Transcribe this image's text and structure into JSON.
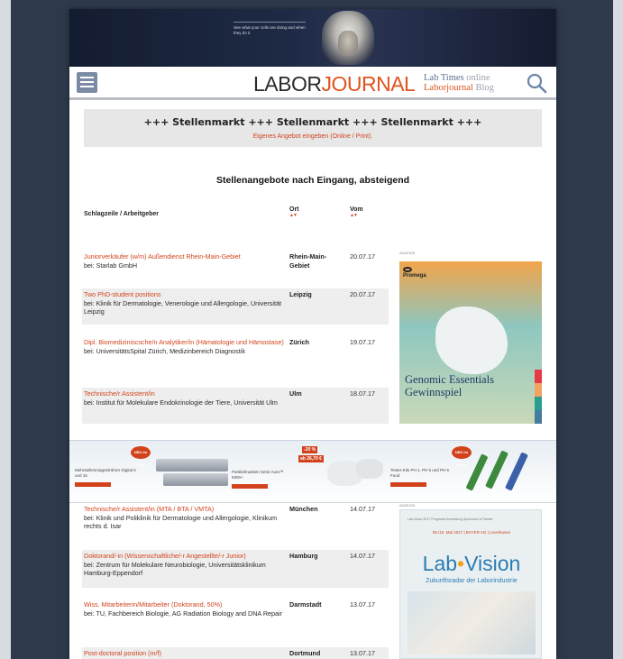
{
  "banner": {
    "small_text": "",
    "tagline": "See what your cells are doing and when they do it"
  },
  "header": {
    "logo_part1": "LABOR",
    "logo_part2": "JOURNAL",
    "link1_main": "Lab Times",
    "link1_suffix": " online",
    "link2_main": "Laborjournal",
    "link2_suffix": " Blog"
  },
  "stellenmarkt": {
    "title": "+++ Stellenmarkt +++ Stellenmarkt +++ Stellenmarkt +++",
    "submit_link": "Eigenes Angebot eingeben (Online / Print)."
  },
  "listing": {
    "heading": "Stellenangebote nach Eingang, absteigend",
    "col_headline": "Schlagzeile / Arbeitgeber",
    "col_ort": "Ort",
    "col_vom": "Vom",
    "sort_arrows": "▲▼"
  },
  "jobs": [
    {
      "title": "Juniorverkäufer (w/m) Außendienst Rhein-Main-Gebiet",
      "employer": "bei: Starlab GmbH",
      "ort": "Rhein-Main-Gebiet",
      "date": "20.07.17"
    },
    {
      "title": "Two PhD-student positions",
      "employer": "bei: Klinik für Dermatologie, Venerologie und Allergologie, Universität Leipzig",
      "ort": "Leipzig",
      "date": "20.07.17"
    },
    {
      "title": "Dipl. Biomediziniscsche/n Analytiker/in (Hämatologie und Hämostase)",
      "employer": "bei: UniversitätsSpital Zürich, Medizinbereich Diagnostik",
      "ort": "Zürich",
      "date": "19.07.17"
    },
    {
      "title": "Technische/r Assistent/in",
      "employer": "bei: Institut für Molekulare Endokrinologie der Tiere, Universität Ulm",
      "ort": "Ulm",
      "date": "18.07.17"
    },
    {
      "title": "Technische/r Assistent/in (MTA / BTA / VMTA)",
      "employer": "bei: Klinik und Poliklinik für Dermatologie und Allergologie, Klinikum rechts d. Isar",
      "ort": "München",
      "date": "14.07.17"
    },
    {
      "title": "Doktorand/-in (Wissenschaftliche/-r Angestellte/-r Junior)",
      "employer": "bei: Zentrum für Molekulare Neurobiologie, Universitätsklinikum Hamburg-Eppendorf",
      "ort": "Hamburg",
      "date": "14.07.17"
    },
    {
      "title": "Wiss. Mitarbeiterin/Mitarbeiter (Doktorand, 50%)",
      "employer": "bei: TU, Fachbereich Biologie, AG Radiation Biology and DNA Repair",
      "ort": "Darmstadt",
      "date": "13.07.17"
    },
    {
      "title": "Post-doctoral position (m/f)",
      "employer": "",
      "ort": "Dortmund",
      "date": "13.07.17"
    }
  ],
  "ads": {
    "label": "ANZEIGE",
    "promega_brand": "Promega",
    "promega_line1": "Genomic Essentials",
    "promega_line2": "Gewinnspiel",
    "labvision_nav": "Lab-Vision 2017   Programm   Anmeldung   Sponsoren & Partner",
    "labvision_date": "09./10. Mai 2017 | BAYER AG | Leverkusen",
    "labvision_logo1": "Lab",
    "labvision_dot": "•",
    "labvision_logo2": "Vision",
    "labvision_sub": "Zukunftsradar der Laborindustrie"
  },
  "product_banner": {
    "item1": "Mehrstellenmagnetrührer Digital 6 und 15",
    "item2": "Partikelmasken Serie Aura™ 9300+",
    "item3": "Tester-Kits PH 1, PH 5 und PH 5 Food",
    "badge": "NEU im Shop",
    "discount": "-20 %",
    "price": "ab 26,70 €"
  },
  "colors": {
    "accent": "#d2431c",
    "header_link_blue": "#5a6f92",
    "menu_button": "#7b8ba4"
  }
}
